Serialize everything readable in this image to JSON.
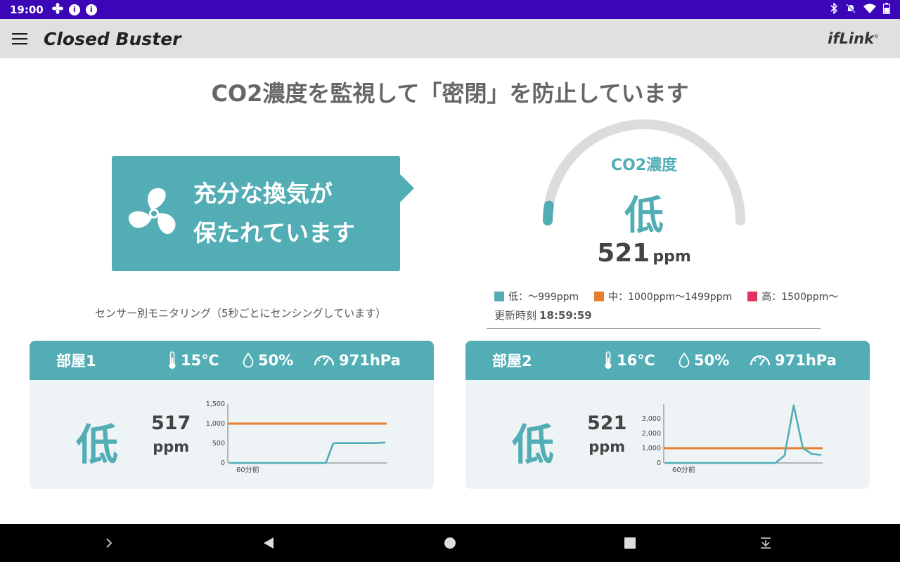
{
  "status_bar": {
    "time": "19:00"
  },
  "app_bar": {
    "title": "Closed Buster",
    "brand": "ifLink",
    "brand_mark": "®"
  },
  "headline": "CO2濃度を監視して「密閉」を防止しています",
  "status_card": {
    "line1": "充分な換気が",
    "line2": "保たれています"
  },
  "gauge": {
    "title": "CO2濃度",
    "level": "低",
    "value": "521",
    "unit": "ppm",
    "fraction": 0.05
  },
  "legend": [
    {
      "label": "低：〜999ppm",
      "color": "#52adb5"
    },
    {
      "label": "中：1000ppm〜1499ppm",
      "color": "#e87e2e"
    },
    {
      "label": "高：1500ppm〜",
      "color": "#e03360"
    }
  ],
  "updated": {
    "label": "更新時刻",
    "time": "18:59:59"
  },
  "monitor_note": "センサー別モニタリング（5秒ごとにセンシングしています）",
  "colors": {
    "teal": "#52adb5",
    "orange": "#e87e2e",
    "red": "#e03360"
  },
  "rooms": [
    {
      "name": "部屋1",
      "temp": "15℃",
      "humidity": "50%",
      "pressure": "971hPa",
      "level": "低",
      "value": "517",
      "unit": "ppm",
      "chart_data": {
        "type": "line",
        "ylim": [
          0,
          1500
        ],
        "yticks": [
          "0",
          "500",
          "1,000",
          "1,500"
        ],
        "ytick_values": [
          0,
          500,
          1000,
          1500
        ],
        "x_label": "60分前",
        "threshold": 1000,
        "values": [
          0,
          0,
          0,
          0,
          0,
          0,
          0,
          0,
          0,
          0,
          0,
          0,
          0,
          0,
          500,
          505,
          505,
          505,
          505,
          505,
          510,
          520
        ]
      }
    },
    {
      "name": "部屋2",
      "temp": "16℃",
      "humidity": "50%",
      "pressure": "971hPa",
      "level": "低",
      "value": "521",
      "unit": "ppm",
      "chart_data": {
        "type": "line",
        "ylim": [
          0,
          4000
        ],
        "yticks": [
          "0",
          "1,000",
          "2,000",
          "3,000"
        ],
        "ytick_values": [
          0,
          1000,
          2000,
          3000
        ],
        "x_label": "60分前",
        "threshold": 1000,
        "values": [
          0,
          0,
          0,
          0,
          0,
          0,
          0,
          0,
          0,
          0,
          0,
          0,
          0,
          500,
          3900,
          1000,
          600,
          550
        ]
      }
    }
  ]
}
